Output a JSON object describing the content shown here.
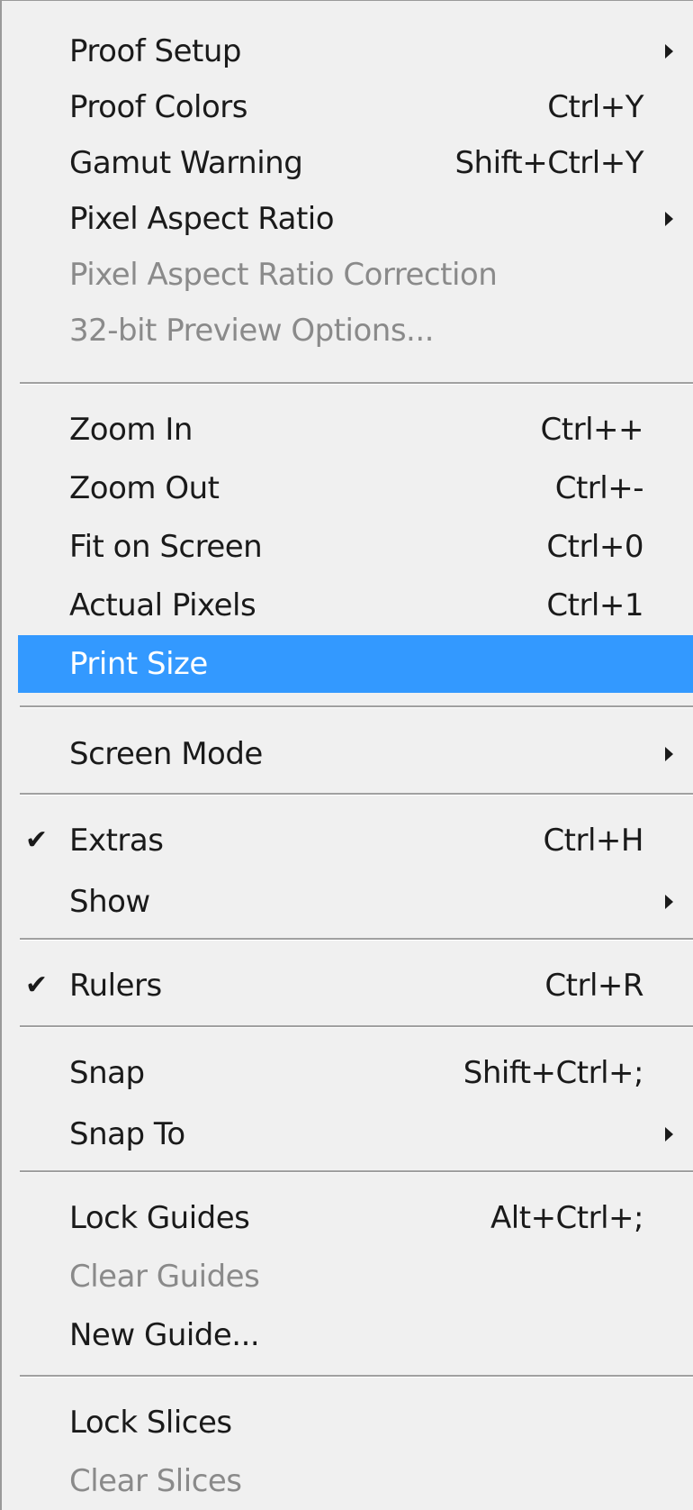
{
  "menu": {
    "items": [
      {
        "label": "Proof Setup",
        "shortcut": "",
        "submenu": true
      },
      {
        "label": "Proof Colors",
        "shortcut": "Ctrl+Y"
      },
      {
        "label": "Gamut Warning",
        "shortcut": "Shift+Ctrl+Y"
      },
      {
        "label": "Pixel Aspect Ratio",
        "shortcut": "",
        "submenu": true
      },
      {
        "label": "Pixel Aspect Ratio Correction",
        "shortcut": "",
        "disabled": true
      },
      {
        "label": "32-bit Preview Options...",
        "shortcut": "",
        "disabled": true
      },
      {
        "label": "Zoom In",
        "shortcut": "Ctrl++"
      },
      {
        "label": "Zoom Out",
        "shortcut": "Ctrl+-"
      },
      {
        "label": "Fit on Screen",
        "shortcut": "Ctrl+0"
      },
      {
        "label": "Actual Pixels",
        "shortcut": "Ctrl+1"
      },
      {
        "label": "Print Size",
        "shortcut": "",
        "highlighted": true
      },
      {
        "label": "Screen Mode",
        "shortcut": "",
        "submenu": true
      },
      {
        "label": "Extras",
        "shortcut": "Ctrl+H",
        "checked": true
      },
      {
        "label": "Show",
        "shortcut": "",
        "submenu": true
      },
      {
        "label": "Rulers",
        "shortcut": "Ctrl+R",
        "checked": true
      },
      {
        "label": "Snap",
        "shortcut": "Shift+Ctrl+;"
      },
      {
        "label": "Snap To",
        "shortcut": "",
        "submenu": true
      },
      {
        "label": "Lock Guides",
        "shortcut": "Alt+Ctrl+;"
      },
      {
        "label": "Clear Guides",
        "shortcut": "",
        "disabled": true
      },
      {
        "label": "New Guide...",
        "shortcut": ""
      },
      {
        "label": "Lock Slices",
        "shortcut": ""
      },
      {
        "label": "Clear Slices",
        "shortcut": "",
        "disabled": true
      }
    ],
    "check_glyph": "✔",
    "colors": {
      "background": "#f0f0f0",
      "highlight": "#3399ff",
      "disabled_text": "#8a8a8a",
      "text": "#1a1a1a"
    }
  }
}
